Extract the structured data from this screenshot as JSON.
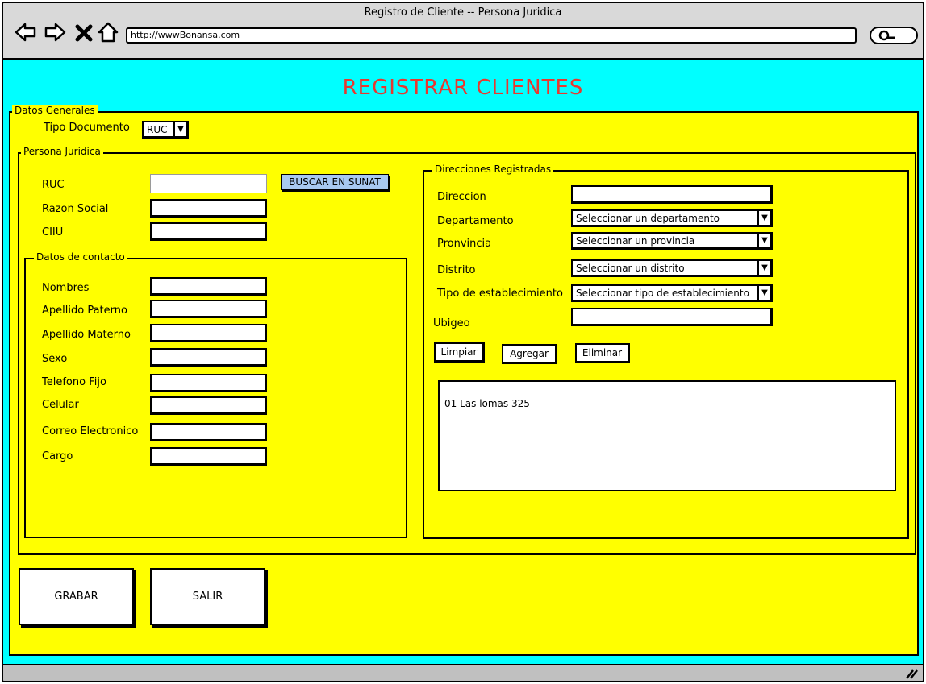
{
  "window": {
    "title": "Registro de Cliente -- Persona Juridica",
    "url": "http://wwwBonansa.com"
  },
  "page": {
    "heading": "REGISTRAR CLIENTES",
    "heading_color": "#e8382f",
    "background": "#00ffff",
    "panel_color": "#ffff00"
  },
  "datos_generales": {
    "legend": "Datos Generales",
    "tipo_documento_label": "Tipo Documento",
    "tipo_documento_value": "RUC"
  },
  "persona_juridica": {
    "legend": "Persona Juridica",
    "ruc_label": "RUC",
    "buscar_button": "BUSCAR EN SUNAT",
    "razon_social_label": "Razon Social",
    "ciiu_label": "CIIU"
  },
  "contacto": {
    "legend": "Datos de contacto",
    "nombres_label": "Nombres",
    "apellido_paterno_label": "Apellido Paterno",
    "apellido_materno_label": "Apellido Materno",
    "sexo_label": "Sexo",
    "telefono_label": "Telefono Fijo",
    "celular_label": "Celular",
    "correo_label": "Correo Electronico",
    "cargo_label": "Cargo"
  },
  "direcciones": {
    "legend": "Direcciones Registradas",
    "direccion_label": "Direccion",
    "departamento_label": "Departamento",
    "departamento_value": "Seleccionar un departamento",
    "provincia_label": "Pronvincia",
    "provincia_value": "Seleccionar un provincia",
    "distrito_label": "Distrito",
    "distrito_value": "Seleccionar un distrito",
    "tipo_label": "Tipo de establecimiento",
    "tipo_value": "Seleccionar tipo de establecimiento",
    "ubigeo_label": "Ubigeo",
    "limpiar_button": "Limpiar",
    "agregar_button": "Agregar",
    "eliminar_button": "Eliminar",
    "list_item": "01  Las lomas 325  ----------------------------------"
  },
  "actions": {
    "grabar": "GRABAR",
    "salir": "SALIR"
  }
}
